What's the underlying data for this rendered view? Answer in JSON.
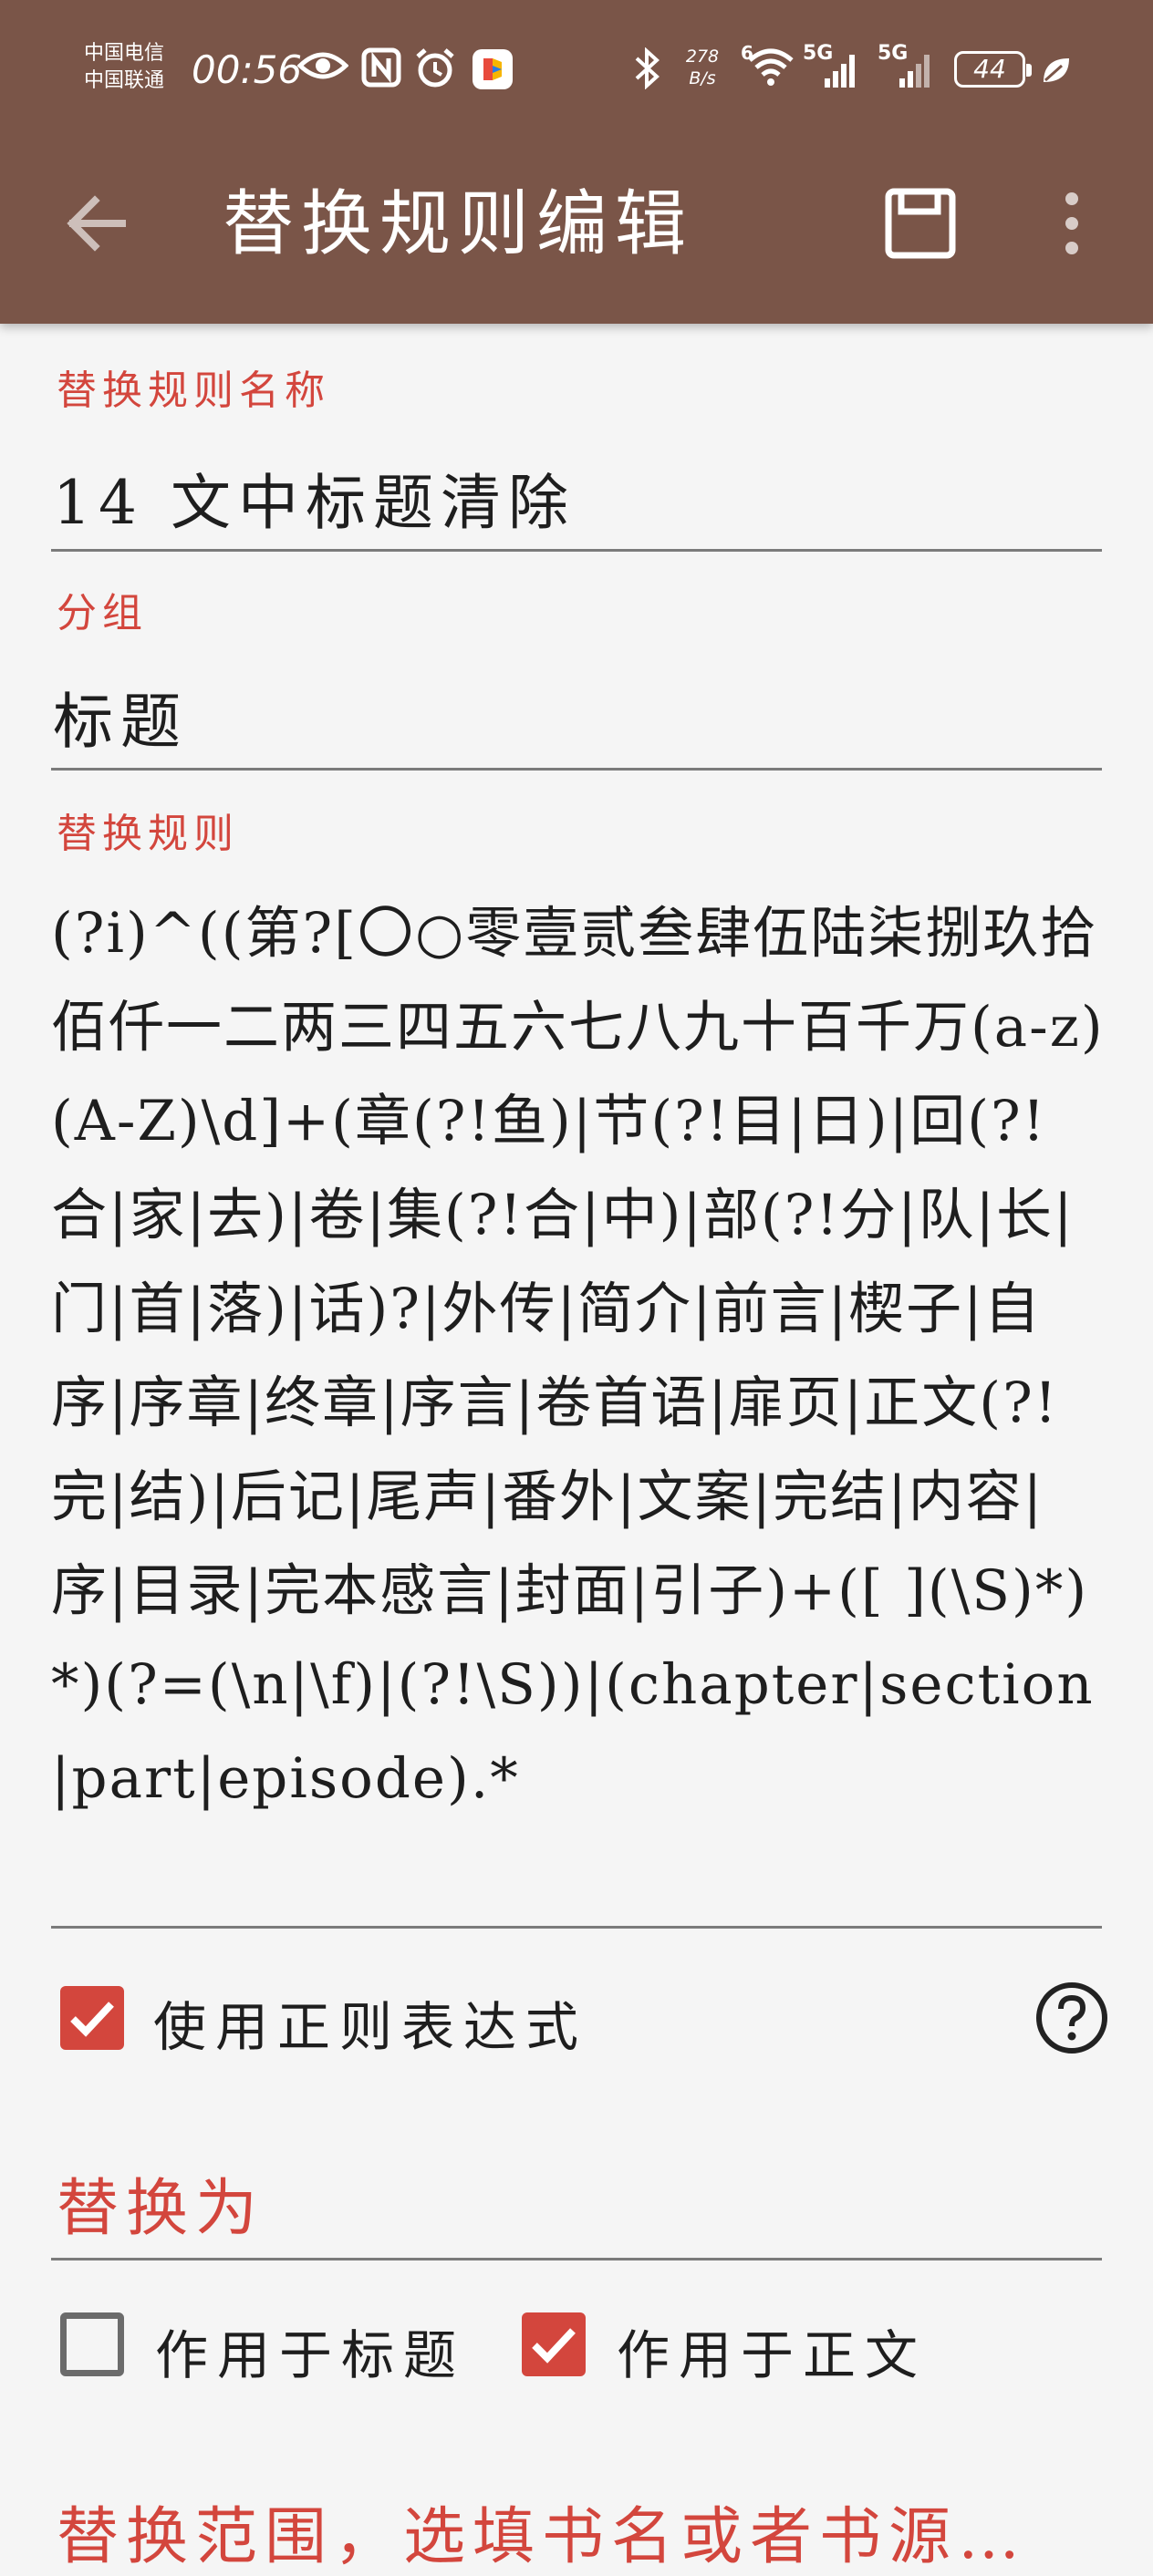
{
  "status_bar": {
    "carrier_1": "中国电信",
    "carrier_2": "中国联通",
    "time": "00:56",
    "net_speed_value": "278",
    "net_speed_unit": "B/s",
    "signal_1": "5G",
    "signal_2": "5G",
    "wifi_badge": "6",
    "battery": "44"
  },
  "toolbar": {
    "title": "替换规则编辑"
  },
  "form": {
    "name_label": "替换规则名称",
    "name_value": "14 文中标题清除",
    "group_label": "分组",
    "group_value": "标题",
    "rule_label": "替换规则",
    "rule_value": "(?i)^((第?[〇○零壹贰叁肆伍陆柒捌玖拾佰仟一二两三四五六七八九十百千万(a-z)(A-Z)\\d]+(章(?!鱼)|节(?!目|日)|回(?!合|家|去)|卷|集(?!合|中)|部(?!分|队|长|门|首|落)|话)?|外传|简介|前言|楔子|自序|序章|终章|序言|卷首语|扉页|正文(?!完|结)|后记|尾声|番外|文案|完结|内容|序|目录|完本感言|封面|引子)+([ ](\\S)*)*)(?=(\\n|\\f)|(?!\\S))|(chapter|section|part|episode).*",
    "use_regex_label": "使用正则表达式",
    "use_regex_checked": true,
    "replace_with_placeholder": "替换为",
    "apply_title_label": "作用于标题",
    "apply_title_checked": false,
    "apply_content_label": "作用于正文",
    "apply_content_checked": true,
    "scope_placeholder": "替换范围，选填书名或者书源…"
  },
  "colors": {
    "appbar": "#7a5548",
    "accent": "#d3463d",
    "background": "#f5f5f5"
  }
}
